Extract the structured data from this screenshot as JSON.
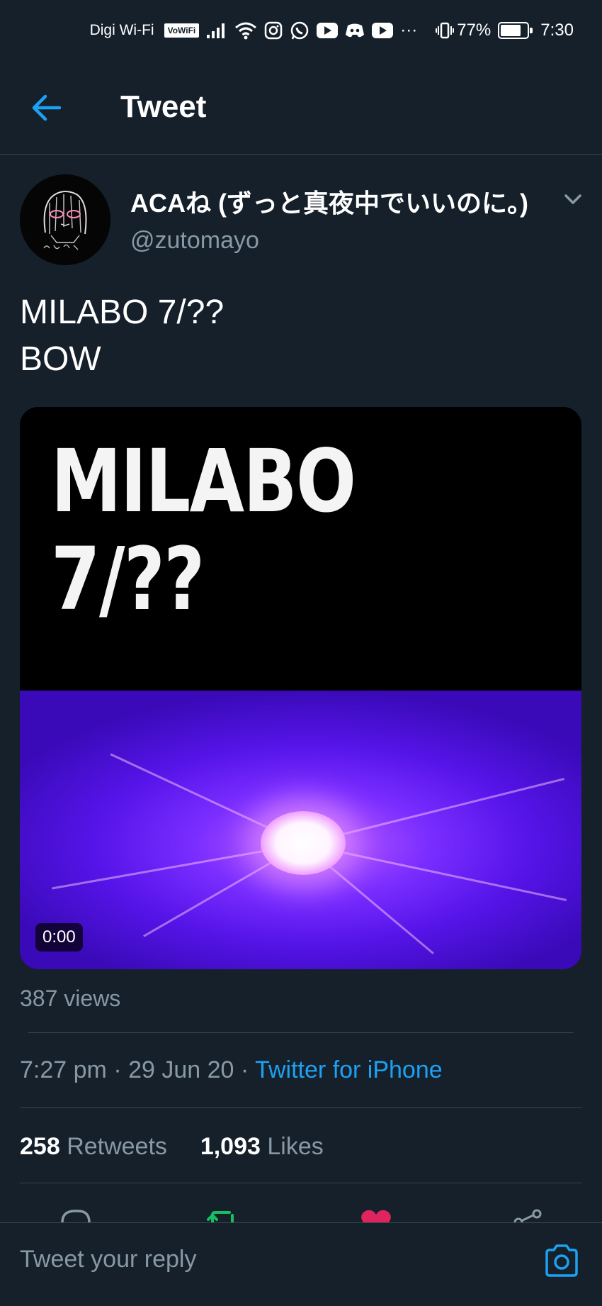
{
  "status_bar": {
    "carrier": "Digi Wi-Fi",
    "vowifi": "VoWiFi",
    "battery_percent": "77%",
    "battery_level": 0.77,
    "time": "7:30",
    "overflow": "···"
  },
  "header": {
    "title": "Tweet"
  },
  "author": {
    "name": "ACAね (ずっと真夜中でいいのに。)",
    "handle": "@zutomayo"
  },
  "tweet": {
    "lines": [
      "MILABO 7/??",
      "BOW"
    ],
    "media": {
      "title_lines": [
        "MILABO",
        "7/??"
      ],
      "duration": "0:00"
    },
    "views": "387 views",
    "time": "7:27 pm",
    "date": "29 Jun 20",
    "separator": "·",
    "source": "Twitter for iPhone"
  },
  "stats": {
    "retweets_count": "258",
    "retweets_label": "Retweets",
    "likes_count": "1,093",
    "likes_label": "Likes"
  },
  "colors": {
    "background": "#15202b",
    "accent": "#1da1f2",
    "secondary_text": "#8899a6",
    "retweet_green": "#17bf63",
    "like_red": "#e0245e"
  },
  "reply": {
    "placeholder": "Tweet your reply"
  }
}
